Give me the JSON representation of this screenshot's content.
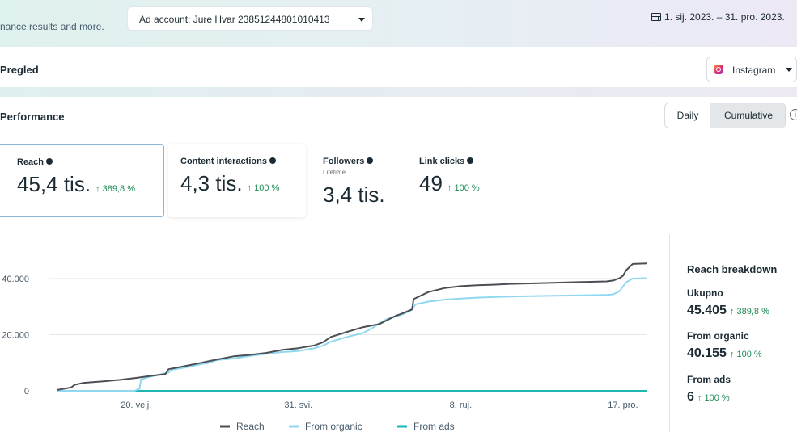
{
  "header": {
    "left_text": "nance results and more.",
    "ad_account_label": "Ad account: Jure Hvar 23851244801010413",
    "date_range": "1. sij. 2023. – 31. pro. 2023."
  },
  "overview": {
    "title": "Pregled",
    "platform": "Instagram"
  },
  "performance": {
    "title": "Performance",
    "toggle": {
      "daily": "Daily",
      "cumulative": "Cumulative",
      "selected": "Cumulative"
    }
  },
  "metrics": [
    {
      "label": "Reach",
      "value": "45,4 tis.",
      "delta": "↑ 389,8 %",
      "selected": true
    },
    {
      "label": "Content interactions",
      "value": "4,3 tis.",
      "delta": "↑ 100 %"
    },
    {
      "label": "Followers",
      "sublabel": "Lifetime",
      "value": "3,4 tis."
    },
    {
      "label": "Link clicks",
      "value": "49",
      "delta": "↑ 100 %"
    }
  ],
  "breakdown": {
    "title": "Reach breakdown",
    "items": [
      {
        "label": "Ukupno",
        "value": "45.405",
        "delta": "↑ 389,8 %"
      },
      {
        "label": "From organic",
        "value": "40.155",
        "delta": "↑ 100 %"
      },
      {
        "label": "From ads",
        "value": "6",
        "delta": "↑ 100 %"
      }
    ]
  },
  "chart_data": {
    "type": "line",
    "yticks": [
      "0",
      "20.000",
      "40.000"
    ],
    "ytick_values": [
      0,
      20000,
      40000
    ],
    "ylim": [
      0,
      40000
    ],
    "xtick_labels": [
      "20. velj.",
      "31. svi.",
      "8. ruj.",
      "17. pro."
    ],
    "xtick_days": [
      50,
      150,
      250,
      350
    ],
    "x_unit": "day of year",
    "xlim": [
      1,
      365
    ],
    "grid": true,
    "legend_position": "bottom",
    "colors": {
      "Reach": "#4b4f54",
      "From organic": "#8fd8f0",
      "From ads": "#1bb7b0"
    },
    "series": [
      {
        "name": "Reach",
        "x": [
          1,
          5,
          10,
          12,
          17,
          20,
          30,
          40,
          50,
          60,
          68,
          70,
          80,
          90,
          100,
          110,
          120,
          130,
          140,
          150,
          160,
          165,
          170,
          180,
          190,
          200,
          205,
          210,
          215,
          220,
          221,
          230,
          240,
          250,
          260,
          270,
          280,
          300,
          320,
          340,
          344,
          348,
          350,
          352,
          356,
          365
        ],
        "y": [
          300,
          700,
          1200,
          2100,
          2800,
          2950,
          3400,
          3900,
          4600,
          5400,
          6000,
          7700,
          8800,
          10000,
          11200,
          12300,
          12800,
          13500,
          14600,
          15200,
          16200,
          17300,
          19200,
          21000,
          22700,
          23800,
          25300,
          26700,
          27800,
          29000,
          32700,
          35200,
          36600,
          37300,
          37600,
          37800,
          38100,
          38400,
          38700,
          39000,
          39300,
          40200,
          41000,
          43000,
          45200,
          45400
        ]
      },
      {
        "name": "From organic",
        "x": [
          1,
          10,
          20,
          30,
          40,
          49,
          50,
          52,
          53,
          60,
          70,
          72,
          80,
          90,
          95,
          100,
          110,
          120,
          130,
          140,
          150,
          160,
          165,
          170,
          180,
          190,
          195,
          200,
          205,
          210,
          215,
          220,
          222,
          230,
          240,
          250,
          260,
          270,
          280,
          300,
          320,
          340,
          344,
          348,
          350,
          352,
          356,
          365
        ],
        "y": [
          0,
          0,
          0,
          0,
          0,
          0,
          300,
          700,
          4100,
          5200,
          6500,
          7500,
          8300,
          9500,
          10000,
          11000,
          11500,
          12400,
          13200,
          13800,
          14200,
          15200,
          16100,
          17500,
          19200,
          20600,
          22200,
          24100,
          25700,
          26500,
          27400,
          28900,
          30800,
          31800,
          32500,
          32900,
          33200,
          33400,
          33600,
          33800,
          34000,
          34200,
          34400,
          35500,
          37200,
          38700,
          40000,
          40155
        ]
      },
      {
        "name": "From ads",
        "x": [
          1,
          365
        ],
        "y": [
          0,
          6
        ]
      }
    ]
  }
}
